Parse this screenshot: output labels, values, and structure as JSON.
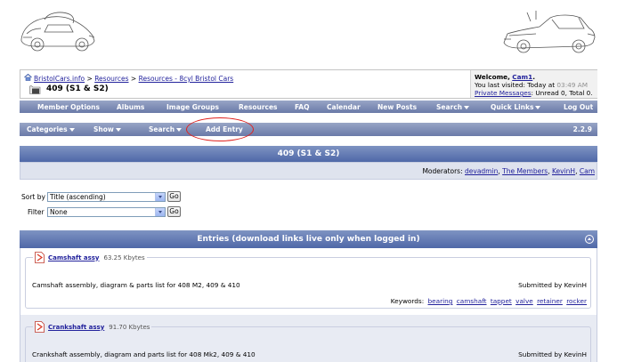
{
  "breadcrumb": {
    "items": [
      "BristolCars.info",
      "Resources",
      "Resources - 8cyl Bristol Cars"
    ],
    "separator": ">",
    "page_title": "409 (S1 & S2)"
  },
  "welcome": {
    "prefix": "Welcome,",
    "username": "Cam1",
    "suffix": ".",
    "last_visited_label": "You last visited: Today at",
    "last_visited_time": "03:49 AM",
    "pm_link": "Private Messages",
    "pm_status": ": Unread 0, Total 0."
  },
  "navbar": {
    "items": [
      "Member Options",
      "Albums",
      "Image Groups",
      "Resources",
      "FAQ",
      "Calendar",
      "New Posts",
      "Search",
      "Quick Links",
      "Log Out"
    ]
  },
  "subnav": {
    "categories": "Categories",
    "show": "Show",
    "search": "Search",
    "add_entry": "Add Entry",
    "version": "2.2.9"
  },
  "category": {
    "title": "409 (S1 & S2)",
    "moderators_label": "Moderators:",
    "moderators": [
      "devadmin",
      "The Members",
      "KevinH",
      "Cam"
    ]
  },
  "sort_form": {
    "sort_label": "Sort by",
    "sort_value": "Title (ascending)",
    "filter_label": "Filter",
    "filter_value": "None",
    "go_label": "Go"
  },
  "entries": {
    "header": "Entries (download links live only when logged in)",
    "items": [
      {
        "name": "Camshaft assy",
        "size": "63.25 Kbytes",
        "description": "Camshaft assembly, diagram & parts list for 408 M2, 409 & 410",
        "submitted": "Submitted by KevinH",
        "keywords_label": "Keywords:",
        "keywords": [
          "bearing",
          "camshaft",
          "tappet",
          "valve",
          "retainer",
          "rocker"
        ]
      },
      {
        "name": "Crankshaft assy",
        "size": "91.70 Kbytes",
        "description": "Crankshaft assembly, diagram and parts list for 408 Mk2, 409 & 410",
        "submitted": "Submitted by KevinH"
      }
    ]
  },
  "colors": {
    "nav_bar": "#6a7aa8",
    "title_bar": "#4f68a8",
    "link": "#22229c",
    "highlight": "#e0221e"
  }
}
